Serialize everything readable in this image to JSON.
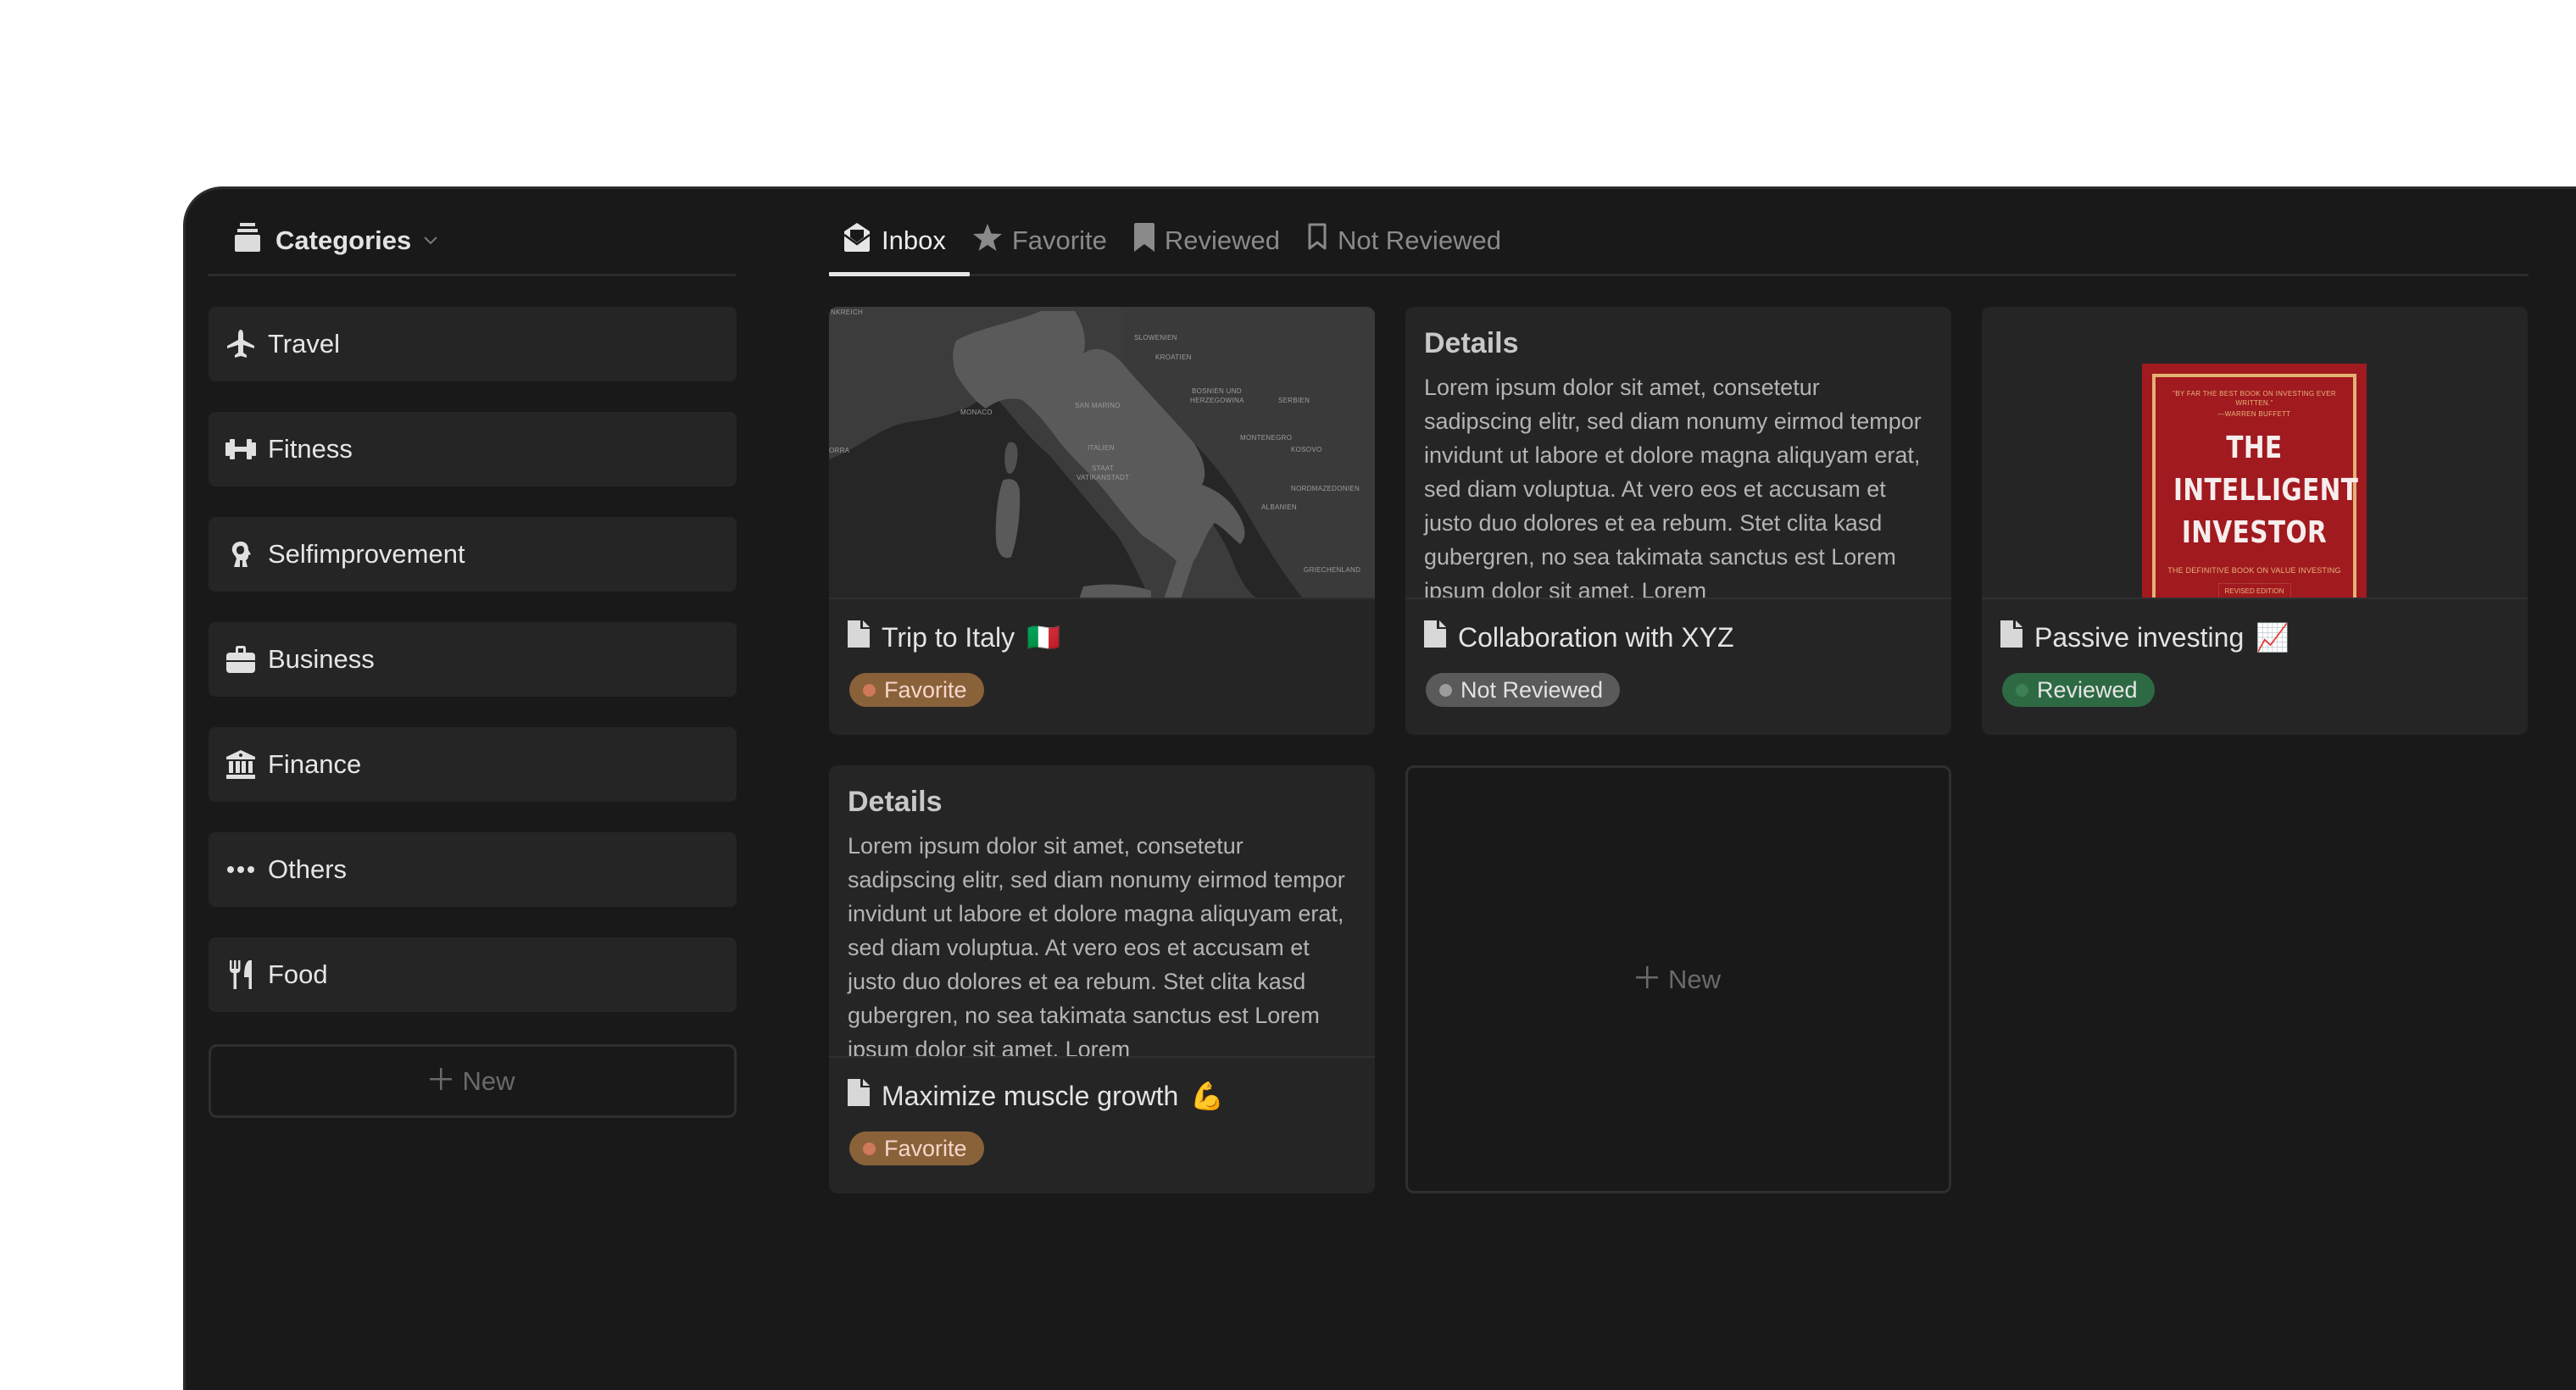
{
  "sidebar": {
    "header": {
      "label": "Categories",
      "icon": "archive-box-icon"
    },
    "items": [
      {
        "label": "Travel",
        "icon": "airplane-icon"
      },
      {
        "label": "Fitness",
        "icon": "dumbbell-icon"
      },
      {
        "label": "Selfimprovement",
        "icon": "head-profile-icon"
      },
      {
        "label": "Business",
        "icon": "briefcase-icon"
      },
      {
        "label": "Finance",
        "icon": "bank-icon"
      },
      {
        "label": "Others",
        "icon": "ellipsis-icon"
      },
      {
        "label": "Food",
        "icon": "fork-knife-icon"
      }
    ],
    "new_label": "New"
  },
  "tabs": [
    {
      "label": "Inbox",
      "icon": "open-envelope-icon",
      "active": true
    },
    {
      "label": "Favorite",
      "icon": "star-icon",
      "active": false
    },
    {
      "label": "Reviewed",
      "icon": "bookmark-filled-icon",
      "active": false
    },
    {
      "label": "Not Reviewed",
      "icon": "bookmark-outline-icon",
      "active": false
    }
  ],
  "cards": [
    {
      "title": "Trip to Italy",
      "emoji": "🇮🇹",
      "badge": {
        "label": "Favorite",
        "kind": "favorite",
        "color": "#8a6239"
      },
      "cover": "map",
      "map_labels": [
        "NKREICH",
        "SLOWENIEN",
        "KROATIEN",
        "BOSNIEN UND",
        "HERZEGOWINA",
        "SERBIEN",
        "SAN MARINO",
        "MONACO",
        "MONTENEGRO",
        "KOSOVO",
        "ITALIEN",
        "STAAT",
        "VATIKANSTADT",
        "NORDMAZEDONIEN",
        "ALBANIEN",
        "GRIECHENLAND",
        "ORRA"
      ]
    },
    {
      "title": "Collaboration with XYZ",
      "emoji": "",
      "badge": {
        "label": "Not Reviewed",
        "kind": "notreviewed",
        "color": "#5a5a5a"
      },
      "cover": "text",
      "details_title": "Details",
      "details_body": "Lorem ipsum dolor sit amet, consetetur sadipscing elitr, sed diam nonumy eirmod tempor invidunt ut labore et dolore magna aliquyam erat, sed diam voluptua. At vero eos et accusam et justo duo dolores et ea rebum. Stet clita kasd gubergren, no sea takimata sanctus est Lorem ipsum dolor sit amet. Lorem"
    },
    {
      "title": "Passive investing",
      "emoji": "📈",
      "badge": {
        "label": "Reviewed",
        "kind": "reviewed",
        "color": "#2d6a43"
      },
      "cover": "book",
      "book": {
        "quote": "\"BY FAR THE BEST BOOK ON INVESTING EVER WRITTEN.\"",
        "quote_author": "—WARREN BUFFETT",
        "title_lines": [
          "THE",
          "INTELLIGENT",
          "INVESTOR"
        ],
        "subtitle": "THE DEFINITIVE BOOK ON VALUE INVESTING",
        "edition": "REVISED EDITION"
      }
    },
    {
      "title": "Maximize muscle growth",
      "emoji": "💪",
      "badge": {
        "label": "Favorite",
        "kind": "favorite",
        "color": "#8a6239"
      },
      "cover": "text",
      "details_title": "Details",
      "details_body": "Lorem ipsum dolor sit amet, consetetur sadipscing elitr, sed diam nonumy eirmod tempor invidunt ut labore et dolore magna aliquyam erat, sed diam voluptua. At vero eos et accusam et justo duo dolores et ea rebum. Stet clita kasd gubergren, no sea takimata sanctus est Lorem ipsum dolor sit amet. Lorem"
    }
  ],
  "new_card_label": "New"
}
